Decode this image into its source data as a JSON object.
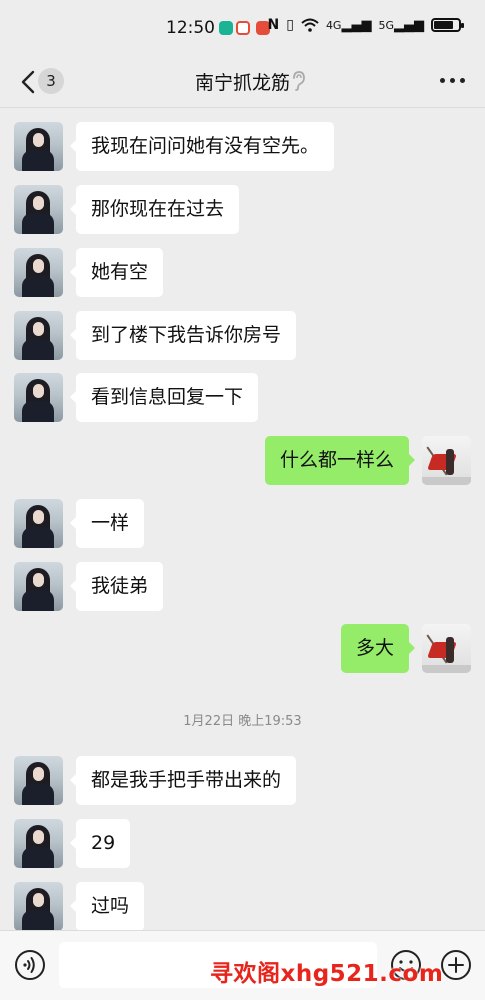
{
  "status_bar": {
    "time": "12:50",
    "network_labels": [
      "4G",
      "5G"
    ],
    "battery_percent": 80,
    "app_icon_colors": [
      "#1ab394",
      "#e64c3c",
      "#e64c3c"
    ]
  },
  "nav": {
    "back_count": "3",
    "title": "南宁抓龙筋"
  },
  "messages": [
    {
      "side": "left",
      "text": "我现在问问她有没有空先。"
    },
    {
      "side": "left",
      "text": "那你现在在过去"
    },
    {
      "side": "left",
      "text": "她有空"
    },
    {
      "side": "left",
      "text": "到了楼下我告诉你房号"
    },
    {
      "side": "left",
      "text": "看到信息回复一下"
    },
    {
      "side": "right",
      "text": "什么都一样么"
    },
    {
      "side": "left",
      "text": "一样"
    },
    {
      "side": "left",
      "text": "我徒弟"
    },
    {
      "side": "right",
      "text": "多大"
    },
    {
      "side": "left",
      "text": "都是我手把手带出来的"
    },
    {
      "side": "left",
      "text": "29"
    },
    {
      "side": "left",
      "text": "过吗"
    }
  ],
  "timestamp": "1月22日 晚上19:53",
  "input": {
    "value": "",
    "placeholder": ""
  },
  "watermark": "寻欢阁xhg521.com",
  "colors": {
    "background": "#ededed",
    "bubble_self": "#95ec69",
    "bubble_other": "#ffffff",
    "watermark": "#e8251c"
  }
}
